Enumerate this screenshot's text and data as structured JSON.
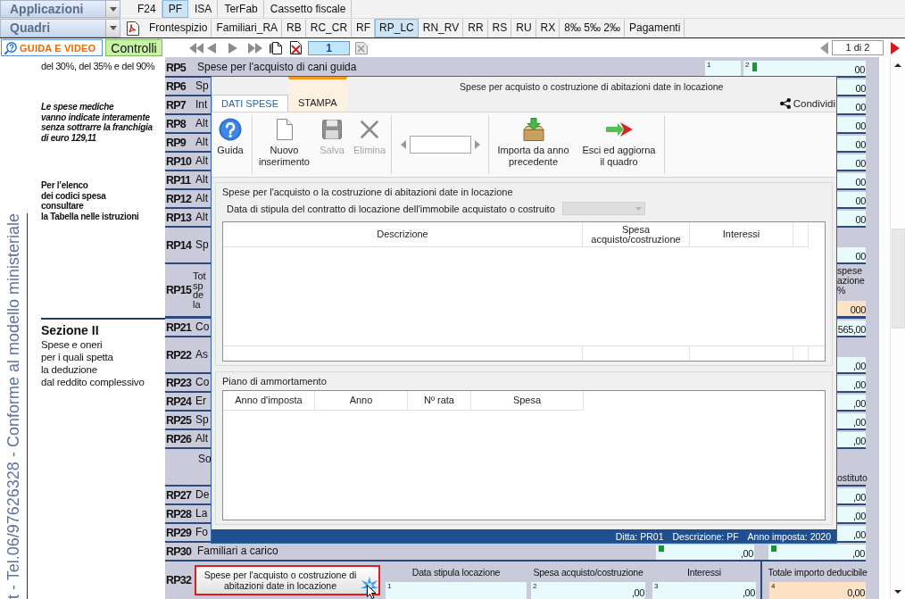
{
  "app_menu": {
    "label": "Applicazioni",
    "tabs": [
      {
        "label": "F24",
        "selected": false
      },
      {
        "label": "PF",
        "selected": true
      },
      {
        "label": "ISA",
        "selected": false
      },
      {
        "label": "TerFab",
        "selected": false
      },
      {
        "label": "Cassetto fiscale",
        "selected": false
      }
    ]
  },
  "sections_menu": {
    "label": "Quadri",
    "tabs": [
      {
        "label": "Frontespizio",
        "selected": false
      },
      {
        "label": "Familiari_RA",
        "selected": false
      },
      {
        "label": "RB",
        "selected": false
      },
      {
        "label": "RC_CR",
        "selected": false
      },
      {
        "label": "RF",
        "selected": false
      },
      {
        "label": "RP_LC",
        "selected": true
      },
      {
        "label": "RN_RV",
        "selected": false
      },
      {
        "label": "RR",
        "selected": false
      },
      {
        "label": "RS",
        "selected": false
      },
      {
        "label": "RU",
        "selected": false
      },
      {
        "label": "RX",
        "selected": false
      },
      {
        "label": "8‰ 5‰ 2‰",
        "selected": false
      },
      {
        "label": "Pagamenti",
        "selected": false
      }
    ]
  },
  "nav_bar": {
    "guide_button": "GUIDA E VIDEO",
    "checks_button": "Controlli",
    "page": "1",
    "page_count": "1 di 2"
  },
  "side_panel": {
    "vertical_text": "t - Tel.06/97626328 - Conforme al modello ministeriale",
    "notes": [
      {
        "kind": "plain",
        "text": "del 30%, del 35% e del 90%"
      },
      {
        "kind": "emphasis",
        "text": "Le spese mediche\nvanno indicate interamente\nsenza sottrarre la franchigia\ndi euro 129,11"
      },
      {
        "kind": "bold",
        "text": "Per l’elenco\ndei codici spesa\nconsultare\nla Tabella nelle istruzioni"
      }
    ],
    "section": {
      "title": "Sezione II",
      "text": "Spese e oneri\nper i quali spetta\nla deduzione\ndal reddito complessivo"
    }
  },
  "form": {
    "rows": [
      {
        "kind": "top",
        "code": "RP5",
        "label": "Spese per l'acquisto di cani guida",
        "cells": [
          {
            "index": "1",
            "marker": false,
            "computed": false
          },
          {
            "index": "2",
            "marker": true,
            "computed": false,
            "value": "00"
          }
        ]
      },
      {
        "kind": "line",
        "code": "RP6",
        "label": "Sp",
        "cells": [
          {
            "marker": false,
            "computed": false,
            "value": "00"
          }
        ]
      },
      {
        "kind": "line",
        "code": "RP7",
        "label": "Int",
        "cells": [
          {
            "marker": false,
            "computed": false,
            "value": "00"
          }
        ]
      },
      {
        "kind": "line",
        "code": "RP8",
        "label": "Alt",
        "cells": [
          {
            "marker": false,
            "computed": false,
            "value": "00"
          }
        ]
      },
      {
        "kind": "line",
        "code": "RP9",
        "label": "Alt",
        "cells": [
          {
            "marker": false,
            "computed": false,
            "value": "00"
          }
        ]
      },
      {
        "kind": "line",
        "code": "RP10",
        "label": "Alt",
        "cells": [
          {
            "marker": false,
            "computed": false,
            "value": "00"
          }
        ]
      },
      {
        "kind": "line",
        "code": "RP11",
        "label": "Alt",
        "cells": [
          {
            "marker": false,
            "computed": false,
            "value": "00"
          }
        ]
      },
      {
        "kind": "line",
        "code": "RP12",
        "label": "Alt",
        "cells": [
          {
            "marker": false,
            "computed": false,
            "value": "00"
          }
        ]
      },
      {
        "kind": "line",
        "code": "RP13",
        "label": "Alt",
        "cells": [
          {
            "marker": false,
            "computed": false,
            "value": "00"
          }
        ]
      },
      {
        "kind": "double",
        "code": "RP14",
        "label": "Sp",
        "cells": [
          {
            "marker": false,
            "computed": false,
            "value": "00"
          }
        ]
      },
      {
        "kind": "triple",
        "code": "RP15",
        "label": "Tot\nsp\nde\nla",
        "note": "spese\nazione\n%",
        "cells": [
          {
            "marker": false,
            "computed": true,
            "value": "000"
          }
        ]
      },
      {
        "kind": "line",
        "code": "RP21",
        "label": "Co",
        "cells": [
          {
            "marker": false,
            "computed": false,
            "value": "565,00"
          }
        ]
      },
      {
        "kind": "double",
        "code": "RP22",
        "label": "As",
        "cells": [
          {
            "marker": false,
            "computed": false,
            "value": ",00"
          }
        ]
      },
      {
        "kind": "line",
        "code": "RP23",
        "label": "Co",
        "cells": [
          {
            "marker": false,
            "computed": false,
            "value": ",00"
          }
        ]
      },
      {
        "kind": "line",
        "code": "RP24",
        "label": "Er",
        "cells": [
          {
            "marker": false,
            "computed": false,
            "value": ",00"
          }
        ]
      },
      {
        "kind": "line",
        "code": "RP25",
        "label": "Sp",
        "cells": [
          {
            "marker": false,
            "computed": false,
            "value": ",00"
          }
        ]
      },
      {
        "kind": "line",
        "code": "RP26",
        "label": "Alt",
        "cells": [
          {
            "marker": false,
            "computed": false,
            "value": ",00"
          }
        ]
      },
      {
        "kind": "heading",
        "label": "So",
        "note": "ostituto"
      },
      {
        "kind": "line",
        "code": "RP27",
        "label": "De",
        "cells": [
          {
            "marker": false,
            "computed": false,
            "value": ",00"
          }
        ]
      },
      {
        "kind": "line",
        "code": "RP28",
        "label": "La",
        "cells": [
          {
            "marker": false,
            "computed": false,
            "value": ",00"
          }
        ]
      },
      {
        "kind": "line",
        "code": "RP29",
        "label": "Fo",
        "cells": [
          {
            "marker": false,
            "computed": false,
            "value": ",00"
          }
        ]
      },
      {
        "kind": "pair",
        "code": "RP30",
        "label": "Familiari a carico",
        "cells": [
          {
            "marker": true,
            "computed": false,
            "value": ",00"
          },
          {
            "marker": true,
            "computed": false,
            "value": ",00"
          }
        ]
      }
    ],
    "summary_row": {
      "code": "RP32",
      "button": {
        "label": "Spese per l'acquisto o costruzione di\nabitazioni date in locazione",
        "highlighted": true
      },
      "columns": [
        {
          "header": "Data stipula locazione",
          "index": "1",
          "computed": false
        },
        {
          "header": "Spesa acquisto/costruzione",
          "index": "2",
          "value": ",00",
          "computed": false
        },
        {
          "header": "Interessi",
          "index": "3",
          "value": ",00",
          "computed": false
        },
        {
          "header": "Totale importo deducibile",
          "index": "4",
          "value": "0,00",
          "computed": true
        }
      ]
    }
  },
  "dialog": {
    "title": "Spese per acquisto o costruzione di abitazioni date in locazione",
    "tabs": [
      {
        "label": "DATI SPESE",
        "selected": true,
        "hovered": false
      },
      {
        "label": "STAMPA",
        "selected": false,
        "hovered": true
      }
    ],
    "share": "Condividi",
    "ribbon": [
      {
        "items": [
          {
            "kind": "help",
            "label": "Guida",
            "disabled": false
          }
        ]
      },
      {
        "items": [
          {
            "kind": "new",
            "label": "Nuovo\ninserimento",
            "disabled": false
          },
          {
            "kind": "save",
            "label": "Salva",
            "disabled": true
          },
          {
            "kind": "delete",
            "label": "Elimina",
            "disabled": true
          }
        ]
      },
      {
        "items": [
          {
            "kind": "pager",
            "disabled": false
          }
        ]
      },
      {
        "items": [
          {
            "kind": "import",
            "label": "Importa da anno\nprecedente",
            "disabled": false
          },
          {
            "kind": "exit",
            "label": "Esci ed aggiorna\nil quadro",
            "disabled": false
          }
        ]
      }
    ],
    "expenses": {
      "title": "Spese per l'acquisto o la costruzione di abitazioni date in locazione",
      "date_label": "Data di stipula del contratto di locazione dell'immobile acquistato o costruito",
      "date_field": {
        "disabled": true
      },
      "columns": [
        "Descrizione",
        "Spesa\nacquisto/costruzione",
        "Interessi"
      ]
    },
    "schedule": {
      "title": "Piano di ammortamento",
      "columns": [
        "Anno d'imposta",
        "Anno",
        "Nº rata",
        "Spesa"
      ]
    },
    "status": [
      "Ditta: PR01",
      "Descrizione: PF",
      "Anno imposta: 2020"
    ]
  }
}
